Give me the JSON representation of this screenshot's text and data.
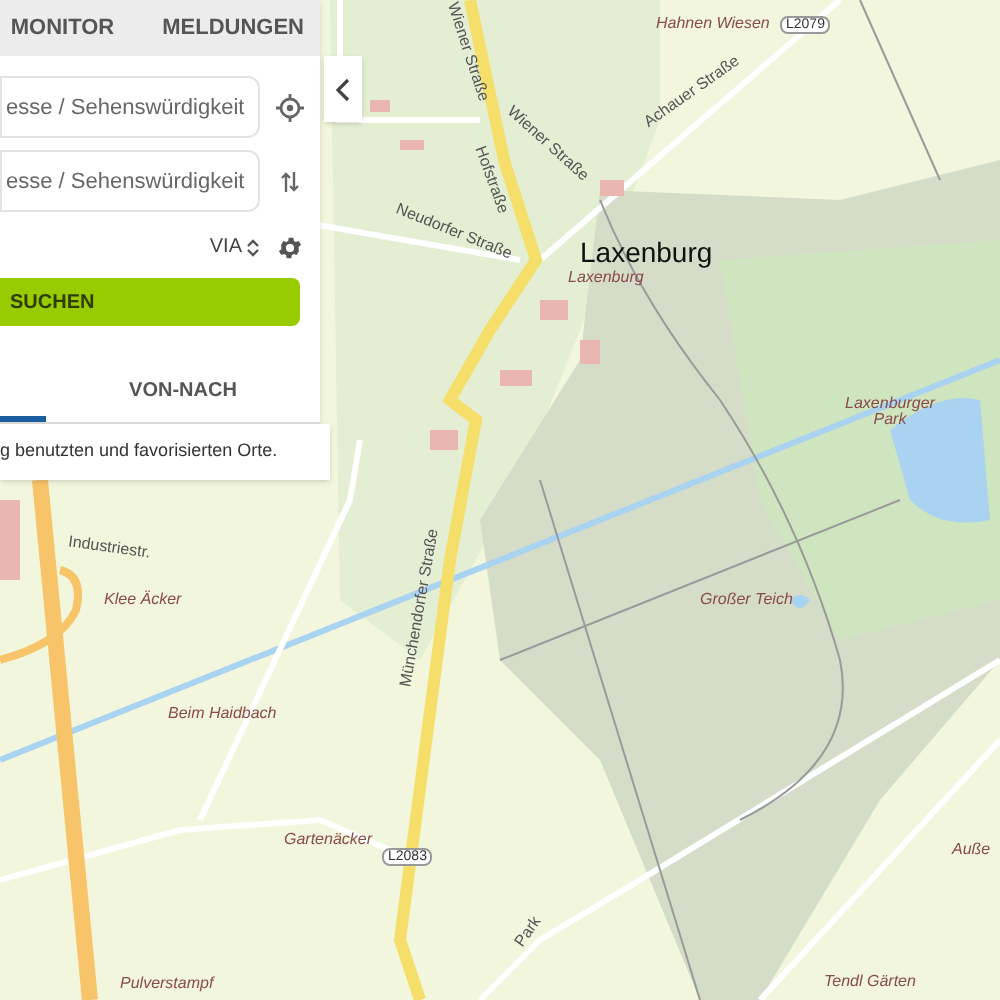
{
  "tabs": [
    {
      "label": "MONITOR",
      "selected": false
    },
    {
      "label": "MELDUNGEN",
      "selected": false
    }
  ],
  "fields": [
    {
      "placeholder": "esse / Sehenswürdigkeit",
      "kind": "locate"
    },
    {
      "placeholder": "esse / Sehenswürdigkeit",
      "kind": "swap"
    }
  ],
  "via": "VIA",
  "search_button": "SUCHEN",
  "mode_tabs": [
    {
      "selected": true
    },
    {
      "label": "VON-NACH",
      "selected": false
    }
  ],
  "note": "g benutzten und favorisierten Orte.",
  "map_labels": [
    {
      "text": "Hahnen Wiesen",
      "kind": "area"
    },
    {
      "text": "L2079",
      "kind": "shield"
    },
    {
      "text": "Achauer Straße",
      "kind": "street"
    },
    {
      "text": "Wiener Straße",
      "kind": "street"
    },
    {
      "text": "Hofstraße",
      "kind": "street"
    },
    {
      "text": "Wiener Straße",
      "kind": "street"
    },
    {
      "text": "Neudorfer Straße",
      "kind": "street"
    },
    {
      "text": "Laxenburg",
      "kind": "town"
    },
    {
      "text": "Laxenburg",
      "kind": "area"
    },
    {
      "text": "Laxenburger Park",
      "kind": "area"
    },
    {
      "text": "Großer Teich",
      "kind": "area"
    },
    {
      "text": "Münchendorfer Straße",
      "kind": "street"
    },
    {
      "text": "Industriestr.",
      "kind": "street"
    },
    {
      "text": "Klee Äcker",
      "kind": "area"
    },
    {
      "text": "Beim Haidbach",
      "kind": "area"
    },
    {
      "text": "Gartenäcker",
      "kind": "area"
    },
    {
      "text": "L2083",
      "kind": "shield"
    },
    {
      "text": "Pulverstampf",
      "kind": "area"
    },
    {
      "text": "Park",
      "kind": "street"
    },
    {
      "text": "Tendl Gärten",
      "kind": "area"
    },
    {
      "text": "Auße",
      "kind": "area"
    }
  ]
}
